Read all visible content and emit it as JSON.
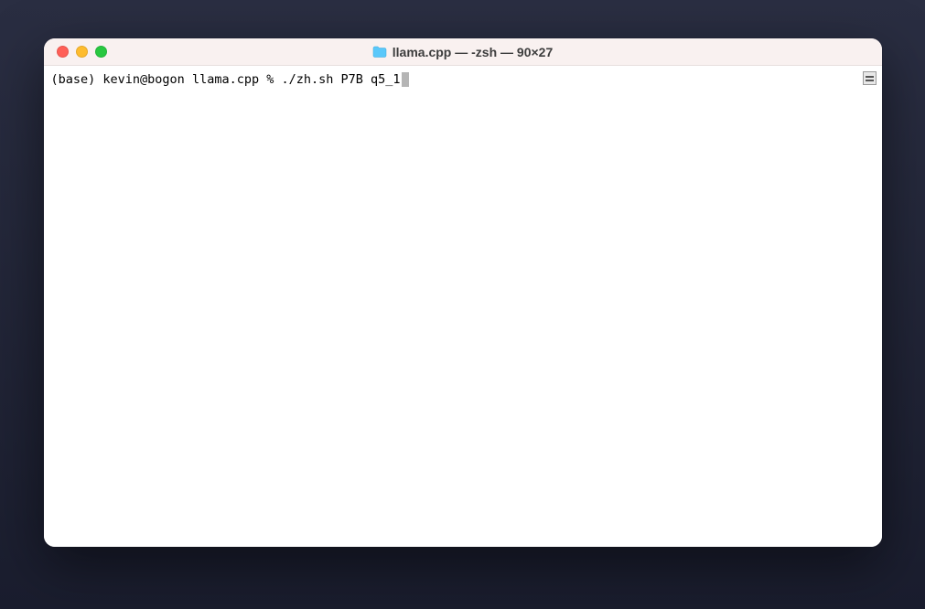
{
  "window": {
    "title": "llama.cpp — -zsh — 90×27",
    "folder_icon": "folder-icon"
  },
  "traffic_lights": {
    "close": "close",
    "minimize": "minimize",
    "maximize": "maximize"
  },
  "terminal": {
    "prompt_env": "(base) ",
    "prompt_user_host": "kevin@bogon ",
    "prompt_dir": "llama.cpp ",
    "prompt_symbol": "% ",
    "command": "./zh.sh P7B q5_1"
  }
}
